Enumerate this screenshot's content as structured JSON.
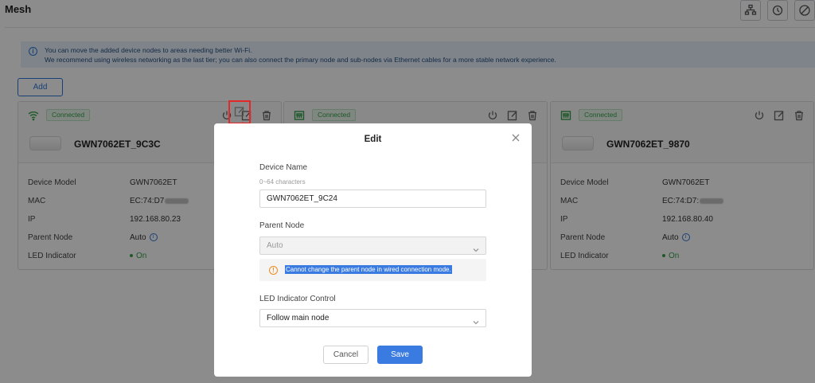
{
  "page": {
    "title": "Mesh"
  },
  "colors": {
    "accent": "#3a7be2",
    "connected": "#37a14c",
    "warning": "#f08a1e",
    "annotation": "#e32828"
  },
  "toolbar": {
    "icons": [
      "topology-icon",
      "scan-icon",
      "block-icon"
    ]
  },
  "notice": {
    "line1": "You can move the added device nodes to areas needing better Wi-Fi.",
    "line2": "We recommend using wireless networking as the last tier; you can also connect the primary node and sub-nodes via Ethernet cables for a more stable network experience."
  },
  "add_label": "Add",
  "card_labels": {
    "model": "Device Model",
    "mac": "MAC",
    "ip": "IP",
    "parent": "Parent Node",
    "led": "LED Indicator"
  },
  "cards": [
    {
      "status": "Connected",
      "name": "GWN7062ET_9C3C",
      "model": "GWN7062ET",
      "mac": "EC:74:D7",
      "ip": "192.168.80.23",
      "parent": "Auto",
      "led": "On"
    },
    {
      "status": "Connected"
    },
    {
      "status": "Connected",
      "name": "GWN7062ET_9870",
      "model": "GWN7062ET",
      "mac": "EC:74:D7:",
      "ip": "192.168.80.40",
      "parent": "Auto",
      "led": "On"
    }
  ],
  "modal": {
    "title": "Edit",
    "device_name_label": "Device Name",
    "device_name_hint": "0~64 characters",
    "device_name_value": "GWN7062ET_9C24",
    "parent_node_label": "Parent Node",
    "parent_node_value": "Auto",
    "parent_node_warning": "Cannot change the parent node in wired connection mode.",
    "led_label": "LED Indicator Control",
    "led_value": "Follow main node",
    "cancel_label": "Cancel",
    "save_label": "Save"
  }
}
